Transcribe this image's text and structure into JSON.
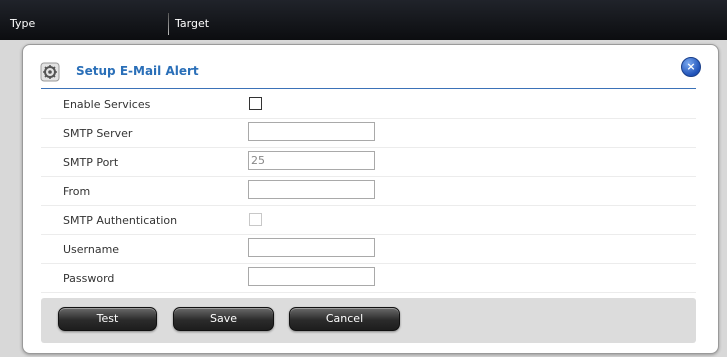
{
  "columns": {
    "type": "Type",
    "target": "Target"
  },
  "dialog": {
    "title": "Setup E-Mail Alert",
    "close_glyph": "×",
    "fields": [
      {
        "label": "Enable Services",
        "type": "checkbox",
        "checked": false,
        "enabled": true
      },
      {
        "label": "SMTP Server",
        "type": "text",
        "value": ""
      },
      {
        "label": "SMTP Port",
        "type": "text",
        "value": "25"
      },
      {
        "label": "From",
        "type": "text",
        "value": ""
      },
      {
        "label": "SMTP Authentication",
        "type": "checkbox",
        "checked": false,
        "enabled": false
      },
      {
        "label": "Username",
        "type": "text",
        "value": ""
      },
      {
        "label": "Password",
        "type": "text",
        "value": ""
      }
    ],
    "buttons": {
      "test": "Test",
      "save": "Save",
      "cancel": "Cancel"
    }
  },
  "colors": {
    "title": "#2a6fb8",
    "close": "#1f52b8",
    "header_bar": "#0c0d10"
  }
}
